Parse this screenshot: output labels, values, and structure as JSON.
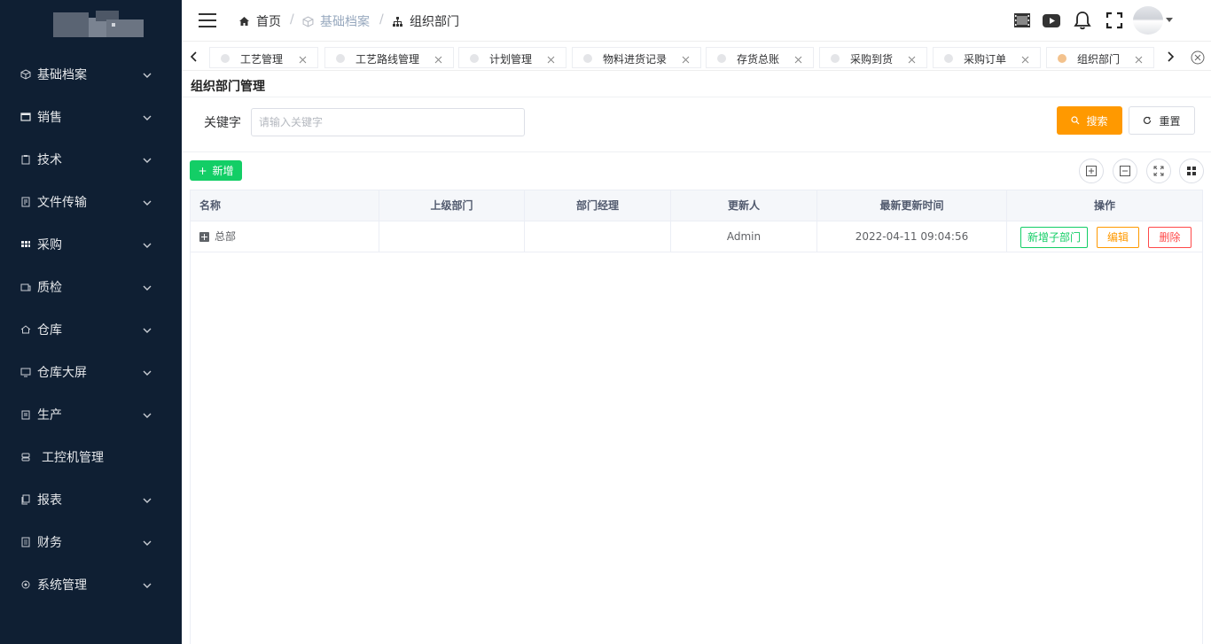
{
  "sidebar": {
    "items": [
      {
        "label": "基础档案",
        "icon": "cube-icon"
      },
      {
        "label": "销售",
        "icon": "window-icon"
      },
      {
        "label": "技术",
        "icon": "clipboard-icon"
      },
      {
        "label": "文件传输",
        "icon": "document-icon"
      },
      {
        "label": "采购",
        "icon": "grid-icon"
      },
      {
        "label": "质检",
        "icon": "inspect-icon"
      },
      {
        "label": "仓库",
        "icon": "home-icon"
      },
      {
        "label": "仓库大屏",
        "icon": "monitor-icon"
      },
      {
        "label": "生产",
        "icon": "calendar-icon"
      },
      {
        "label": "工控机管理",
        "icon": "server-icon"
      },
      {
        "label": "报表",
        "icon": "copy-icon"
      },
      {
        "label": "财务",
        "icon": "ledger-icon"
      },
      {
        "label": "系统管理",
        "icon": "settings-icon"
      }
    ]
  },
  "breadcrumb": {
    "home": "首页",
    "section": "基础档案",
    "current": "组织部门"
  },
  "tags": [
    {
      "label": "工艺管理"
    },
    {
      "label": "工艺路线管理"
    },
    {
      "label": "计划管理"
    },
    {
      "label": "物料进货记录"
    },
    {
      "label": "存货总账"
    },
    {
      "label": "采购到货"
    },
    {
      "label": "采购订单"
    },
    {
      "label": "组织部门"
    }
  ],
  "page": {
    "title": "组织部门管理"
  },
  "search": {
    "keyword_label": "关键字",
    "placeholder": "请输入关键字",
    "value": "",
    "search_label": "搜索",
    "reset_label": "重置"
  },
  "toolbar": {
    "add_label": "新增"
  },
  "table": {
    "headers": [
      "名称",
      "上级部门",
      "部门经理",
      "更新人",
      "最新更新时间",
      "操作"
    ],
    "rows": [
      {
        "name": "总部",
        "parent": "",
        "manager": "",
        "updater": "Admin",
        "updated_at": "2022-04-11 09:04:56",
        "actions": {
          "add_child": "新增子部门",
          "edit": "编辑",
          "delete": "删除"
        }
      }
    ]
  },
  "colors": {
    "sidebar_bg": "#0f1f33",
    "search_btn": "#ff9900",
    "add_btn": "#13ce66",
    "delete": "#ff4949",
    "active_tag_dot": "#f3c28d"
  }
}
